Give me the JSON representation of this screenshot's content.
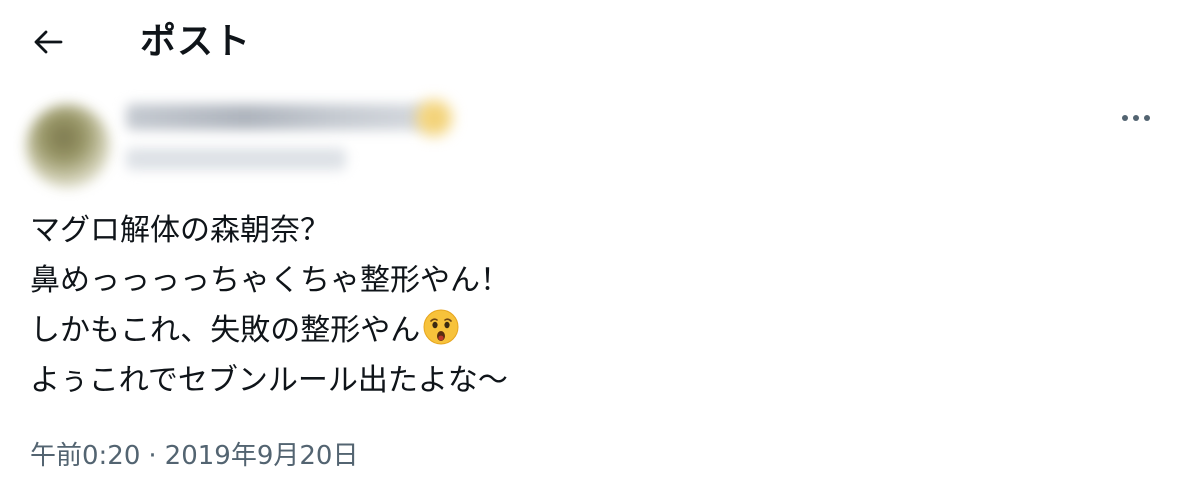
{
  "header": {
    "title": "ポスト",
    "back_icon": "arrow-left-icon"
  },
  "author": {
    "name": "████ ████ ████ ████",
    "handle": "@██████████",
    "obscured": true
  },
  "post": {
    "lines": [
      "マグロ解体の森朝奈？",
      "鼻めっっっっちゃくちゃ整形やん！",
      "しかもこれ、失敗の整形やん",
      "よぅこれでセブンルール出たよな〜"
    ],
    "emoji": "hushed-face-emoji"
  },
  "meta": {
    "time": "午前0:20",
    "separator": "·",
    "date": "2019年9月20日"
  },
  "colors": {
    "text": "#0f1419",
    "secondary_text": "#536471",
    "background": "#ffffff",
    "emoji_face": "#f7c23b"
  }
}
